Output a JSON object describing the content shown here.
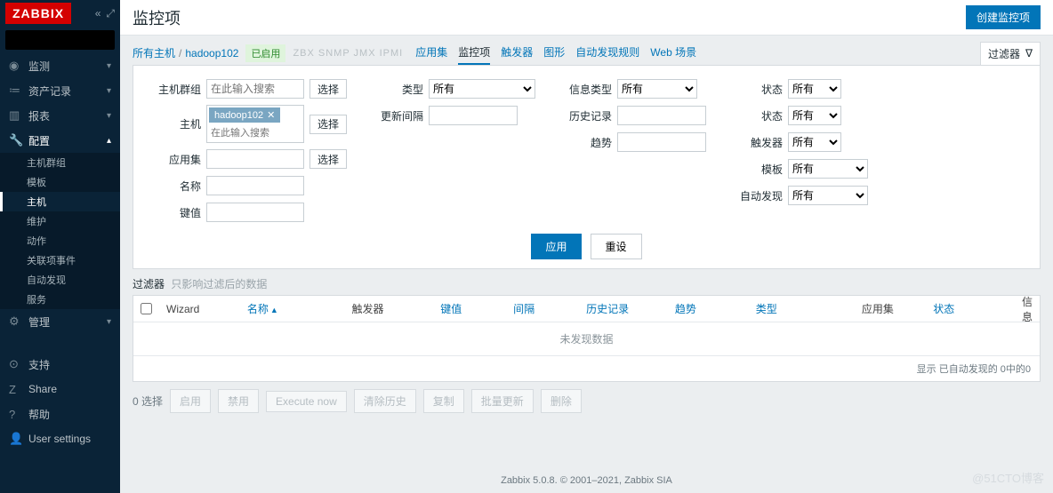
{
  "logo": "ZABBIX",
  "sidebar": {
    "search_placeholder": "",
    "items": [
      {
        "icon": "◉",
        "label": "监测"
      },
      {
        "icon": "≔",
        "label": "资产记录"
      },
      {
        "icon": "▥",
        "label": "报表"
      },
      {
        "icon": "🔧",
        "label": "配置",
        "open": true,
        "sub": [
          "主机群组",
          "模板",
          "主机",
          "维护",
          "动作",
          "关联项事件",
          "自动发现",
          "服务"
        ],
        "active_sub": "主机"
      },
      {
        "icon": "⚙",
        "label": "管理"
      }
    ],
    "bottom": [
      {
        "icon": "⊙",
        "label": "支持"
      },
      {
        "icon": "Z",
        "label": "Share"
      },
      {
        "icon": "?",
        "label": "帮助"
      },
      {
        "icon": "👤",
        "label": "User settings"
      }
    ]
  },
  "page": {
    "title": "监控项",
    "create_btn": "创建监控项",
    "breadcrumb": [
      "所有主机",
      "hadoop102"
    ],
    "status": "已启用",
    "disabled_extra": "ZBX SNMP JMX IPMI",
    "tabs": [
      "应用集",
      "监控项",
      "触发器",
      "图形",
      "自动发现规则",
      "Web 场景"
    ],
    "active_tab": "监控项",
    "filter_label": "过滤器"
  },
  "filter": {
    "group": {
      "label": "主机群组",
      "placeholder": "在此输入搜索",
      "select": "选择"
    },
    "host": {
      "label": "主机",
      "tag": "hadoop102",
      "placeholder": "在此输入搜索",
      "select": "选择"
    },
    "app": {
      "label": "应用集",
      "select": "选择"
    },
    "name": {
      "label": "名称"
    },
    "key": {
      "label": "键值"
    },
    "type": {
      "label": "类型",
      "value": "所有"
    },
    "interval": {
      "label": "更新间隔"
    },
    "info_type": {
      "label": "信息类型",
      "value": "所有"
    },
    "history": {
      "label": "历史记录"
    },
    "trend": {
      "label": "趋势"
    },
    "state": {
      "label": "状态",
      "value": "所有"
    },
    "status": {
      "label": "状态",
      "value": "所有"
    },
    "triggers": {
      "label": "触发器",
      "value": "所有"
    },
    "template": {
      "label": "模板",
      "value": "所有"
    },
    "discovery": {
      "label": "自动发现",
      "value": "所有"
    },
    "apply": "应用",
    "reset": "重设"
  },
  "filter_hint": {
    "label": "过滤器",
    "sub": "只影响过滤后的数据"
  },
  "table": {
    "cols": {
      "wizard": "Wizard",
      "name": "名称",
      "trig": "触发器",
      "key": "键值",
      "intv": "间隔",
      "hist": "历史记录",
      "trend": "趋势",
      "type": "类型",
      "app": "应用集",
      "stat": "状态",
      "info": "信息"
    },
    "sort_indicator": "▲",
    "empty": "未发现数据",
    "footer": "显示 已自动发现的 0中的0"
  },
  "bulk": {
    "count": "0 选择",
    "btns": [
      "启用",
      "禁用",
      "Execute now",
      "清除历史",
      "复制",
      "批量更新",
      "删除"
    ]
  },
  "footer": "Zabbix 5.0.8. © 2001–2021, Zabbix SIA",
  "watermark": "@51CTO博客"
}
